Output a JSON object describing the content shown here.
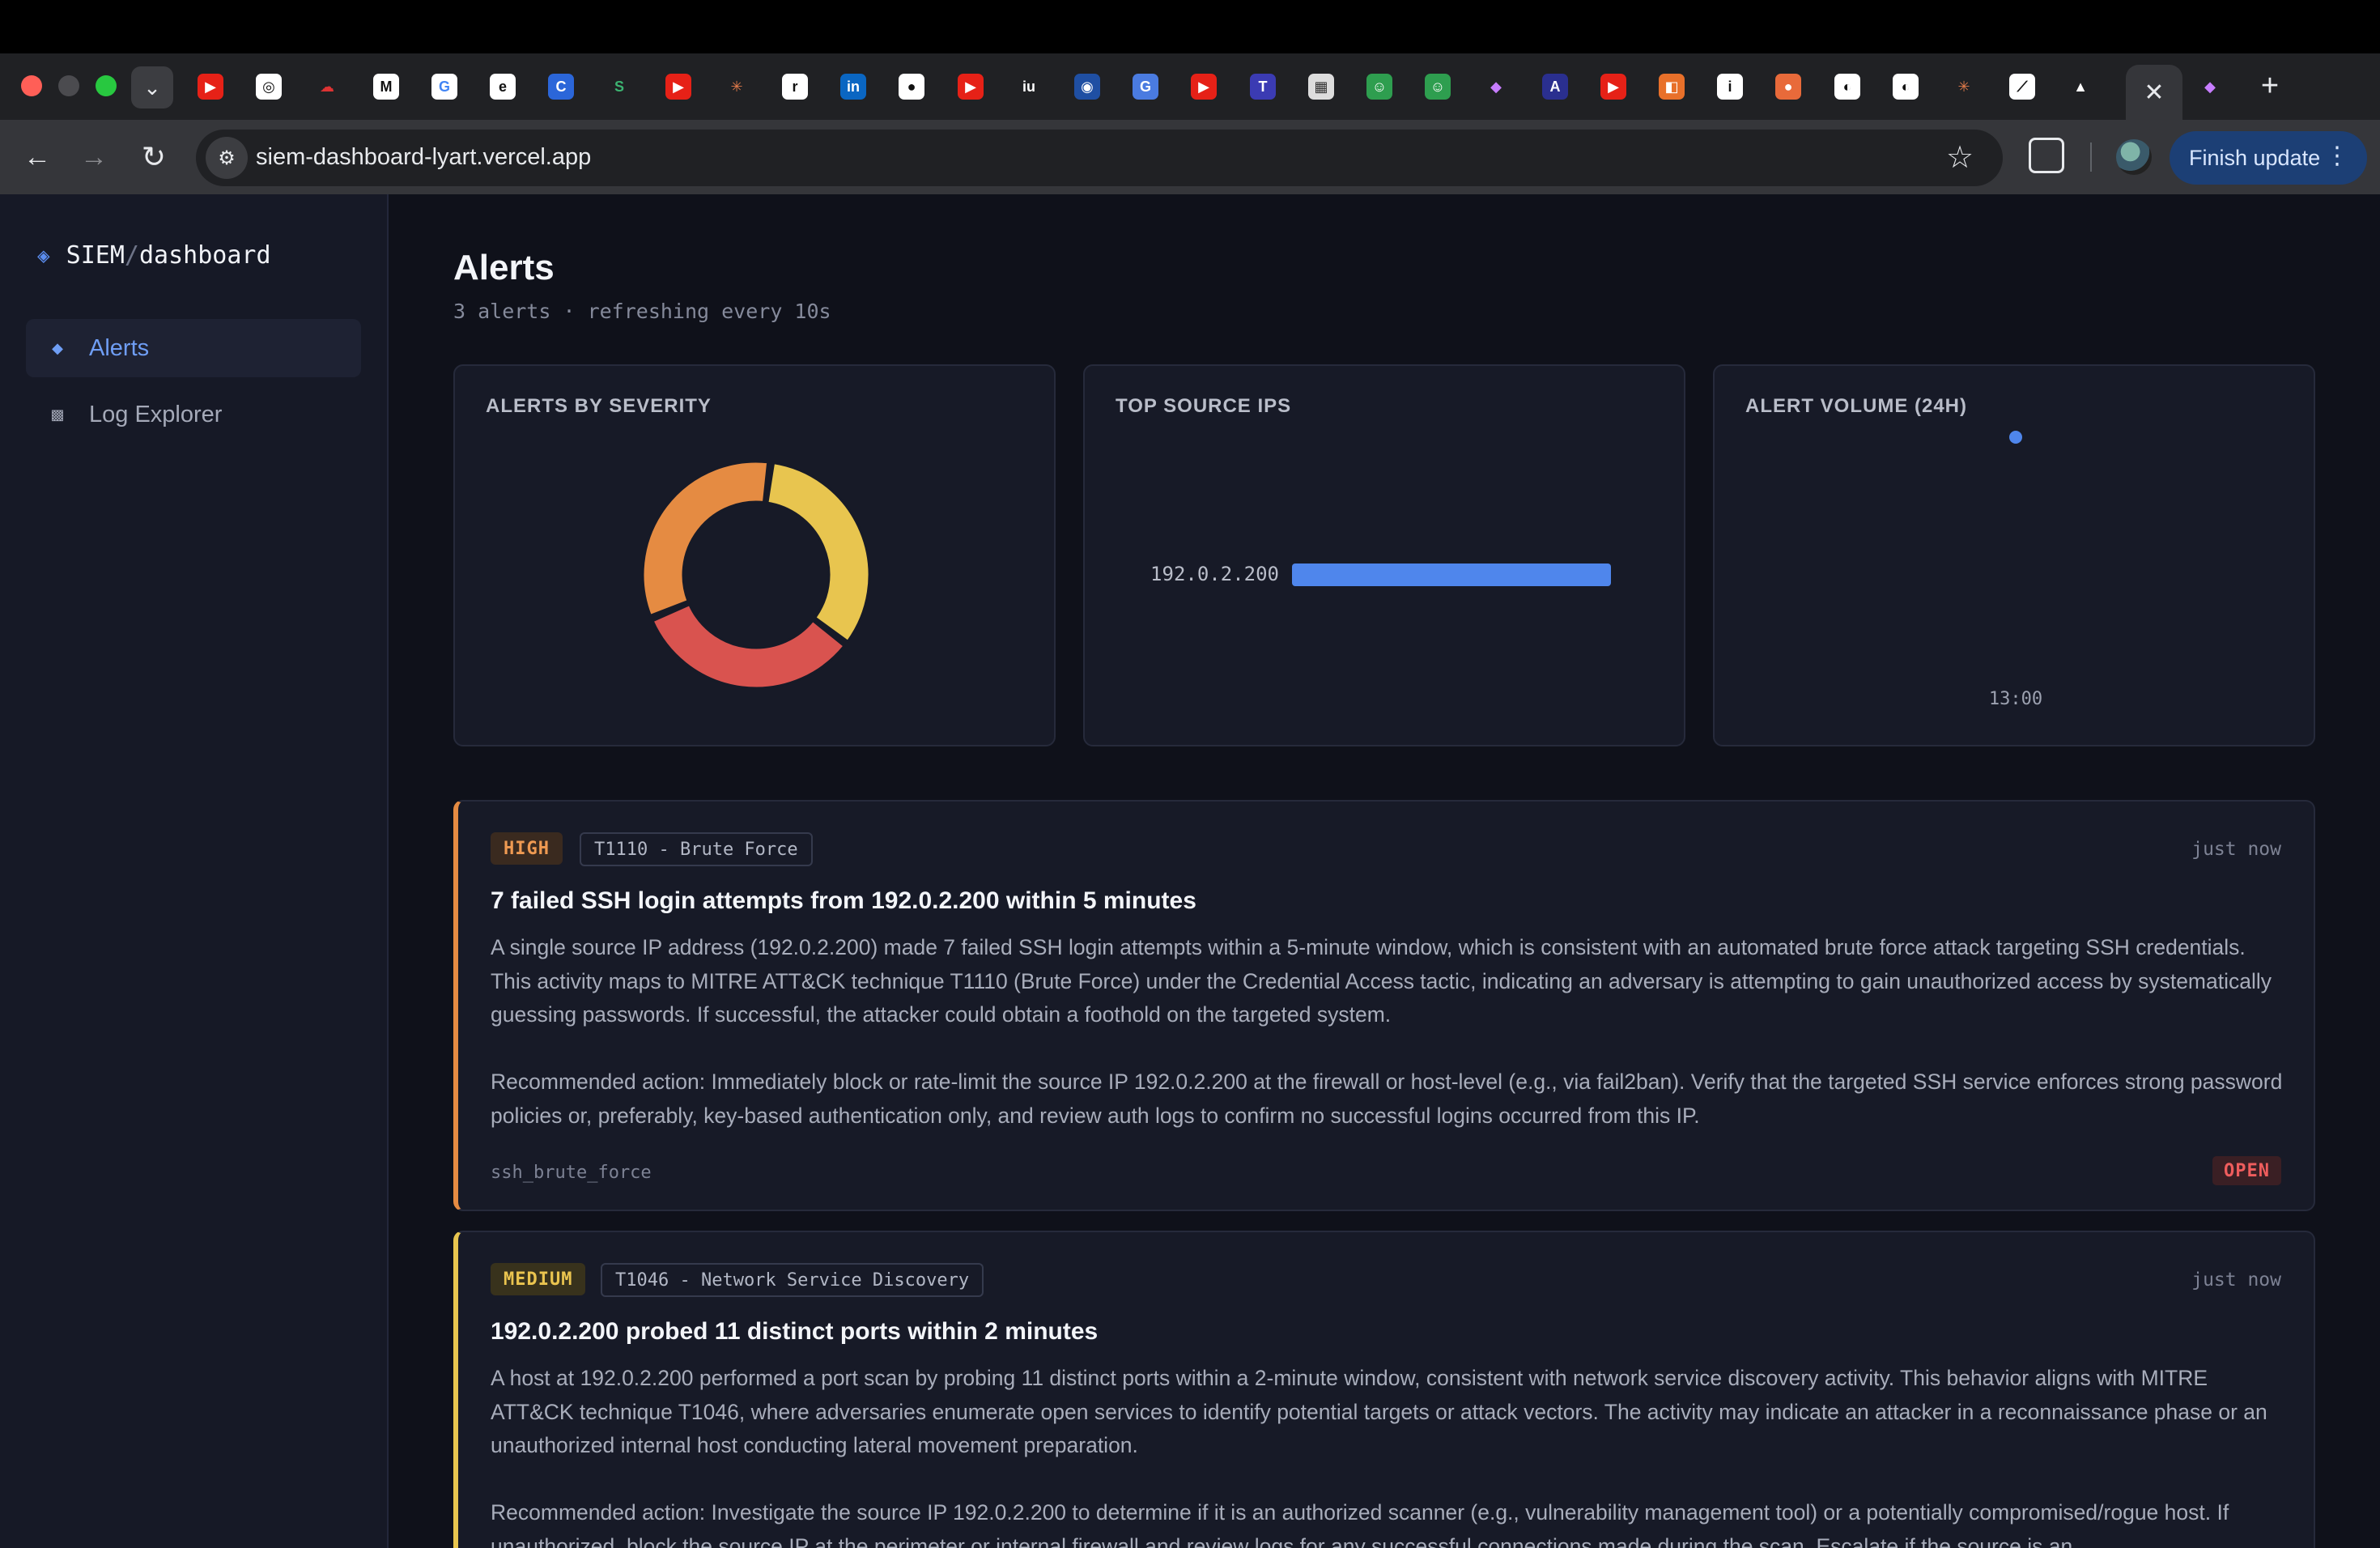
{
  "browser": {
    "url": "siem-dashboard-lyart.vercel.app",
    "finish_update_label": "Finish update",
    "active_tab_close_glyph": "✕",
    "new_tab_glyph": "+",
    "favicons": [
      {
        "glyph": "▶",
        "bg": "#e62117"
      },
      {
        "glyph": "◎",
        "bg": "#ffffff",
        "fg": "#111"
      },
      {
        "glyph": "☁",
        "bg": "transparent",
        "fg": "#d33"
      },
      {
        "glyph": "M",
        "bg": "#ffffff",
        "fg": "#111"
      },
      {
        "glyph": "G",
        "bg": "#ffffff",
        "fg": "#4285f4"
      },
      {
        "glyph": "e",
        "bg": "#ffffff",
        "fg": "#111"
      },
      {
        "glyph": "C",
        "bg": "#2b66d9"
      },
      {
        "glyph": "S",
        "bg": "transparent",
        "fg": "#3cb371"
      },
      {
        "glyph": "▶",
        "bg": "#e62117"
      },
      {
        "glyph": "✳",
        "bg": "transparent",
        "fg": "#e07a4a"
      },
      {
        "glyph": "r",
        "bg": "#ffffff",
        "fg": "#111"
      },
      {
        "glyph": "in",
        "bg": "#0a66c2"
      },
      {
        "glyph": "●",
        "bg": "#ffffff",
        "fg": "#111"
      },
      {
        "glyph": "▶",
        "bg": "#e62117"
      },
      {
        "glyph": "iu",
        "bg": "transparent",
        "fg": "#fff"
      },
      {
        "glyph": "◉",
        "bg": "#1f4fa3"
      },
      {
        "glyph": "G",
        "bg": "#4a7be0"
      },
      {
        "glyph": "▶",
        "bg": "#e62117"
      },
      {
        "glyph": "T",
        "bg": "#3b3bb3"
      },
      {
        "glyph": "▦",
        "bg": "#dddddd",
        "fg": "#333"
      },
      {
        "glyph": "☺",
        "bg": "#2e9e4f"
      },
      {
        "glyph": "☺",
        "bg": "#2e9e4f"
      },
      {
        "glyph": "◆",
        "bg": "transparent",
        "fg": "#c77dff"
      },
      {
        "glyph": "A",
        "bg": "#2a2f8f"
      },
      {
        "glyph": "▶",
        "bg": "#e62117"
      },
      {
        "glyph": "◧",
        "bg": "#e8702a"
      },
      {
        "glyph": "i",
        "bg": "#ffffff",
        "fg": "#111"
      },
      {
        "glyph": "●",
        "bg": "#e86a3a"
      },
      {
        "glyph": "◐",
        "bg": "#ffffff",
        "fg": "#111"
      },
      {
        "glyph": "◐",
        "bg": "#ffffff",
        "fg": "#111"
      },
      {
        "glyph": "✳",
        "bg": "transparent",
        "fg": "#e07a4a"
      },
      {
        "glyph": "⟋",
        "bg": "#ffffff",
        "fg": "#111"
      },
      {
        "glyph": "▲",
        "bg": "transparent",
        "fg": "#fff"
      }
    ],
    "trailing_favicon": {
      "glyph": "◆",
      "bg": "transparent",
      "fg": "#c77dff"
    }
  },
  "sidebar": {
    "brand_prefix": "SIEM",
    "brand_slash": "/",
    "brand_suffix": "dashboard",
    "items": [
      {
        "label": "Alerts",
        "icon": "diamond-icon",
        "active": true
      },
      {
        "label": "Log Explorer",
        "icon": "square-icon",
        "active": false
      }
    ]
  },
  "page": {
    "title": "Alerts",
    "subtitle": "3 alerts · refreshing every 10s"
  },
  "panels": {
    "severity_title": "ALERTS BY SEVERITY",
    "ips_title": "TOP SOURCE IPS",
    "volume_title": "ALERT VOLUME (24H)"
  },
  "chart_data": [
    {
      "type": "pie",
      "title": "ALERTS BY SEVERITY",
      "slices": [
        {
          "name": "",
          "value": 1,
          "color": "#e8c54f"
        },
        {
          "name": "",
          "value": 1,
          "color": "#d9534f"
        },
        {
          "name": "",
          "value": 1,
          "color": "#e58b42"
        }
      ]
    },
    {
      "type": "bar",
      "title": "TOP SOURCE IPS",
      "orientation": "horizontal",
      "categories": [
        "192.0.2.200"
      ],
      "values": [
        3
      ],
      "color": "#4f86ec"
    },
    {
      "type": "line",
      "title": "ALERT VOLUME (24H)",
      "x": [
        "13:00"
      ],
      "y": [
        3
      ],
      "color": "#4f86ec"
    }
  ],
  "alerts": [
    {
      "severity": "HIGH",
      "technique": "T1110 - Brute Force",
      "time": "just now",
      "title": "7 failed SSH login attempts from 192.0.2.200 within 5 minutes",
      "description": "A single source IP address (192.0.2.200) made 7 failed SSH login attempts within a 5-minute window, which is consistent with an automated brute force attack targeting SSH credentials. This activity maps to MITRE ATT&CK technique T1110 (Brute Force) under the Credential Access tactic, indicating an adversary is attempting to gain unauthorized access by systematically guessing passwords. If successful, the attacker could obtain a foothold on the targeted system.\n\nRecommended action: Immediately block or rate-limit the source IP 192.0.2.200 at the firewall or host-level (e.g., via fail2ban). Verify that the targeted SSH service enforces strong password policies or, preferably, key-based authentication only, and review auth logs to confirm no successful logins occurred from this IP.",
      "rule": "ssh_brute_force",
      "status": "OPEN"
    },
    {
      "severity": "MEDIUM",
      "technique": "T1046 - Network Service Discovery",
      "time": "just now",
      "title": "192.0.2.200 probed 11 distinct ports within 2 minutes",
      "description": "A host at 192.0.2.200 performed a port scan by probing 11 distinct ports within a 2-minute window, consistent with network service discovery activity. This behavior aligns with MITRE ATT&CK technique T1046, where adversaries enumerate open services to identify potential targets or attack vectors. The activity may indicate an attacker in a reconnaissance phase or an unauthorized internal host conducting lateral movement preparation.\n\nRecommended action: Investigate the source IP 192.0.2.200 to determine if it is an authorized scanner (e.g., vulnerability management tool) or a potentially compromised/rogue host. If unauthorized, block the source IP at the perimeter or internal firewall and review logs for any successful connections made during the scan. Escalate if the source is an"
    }
  ]
}
